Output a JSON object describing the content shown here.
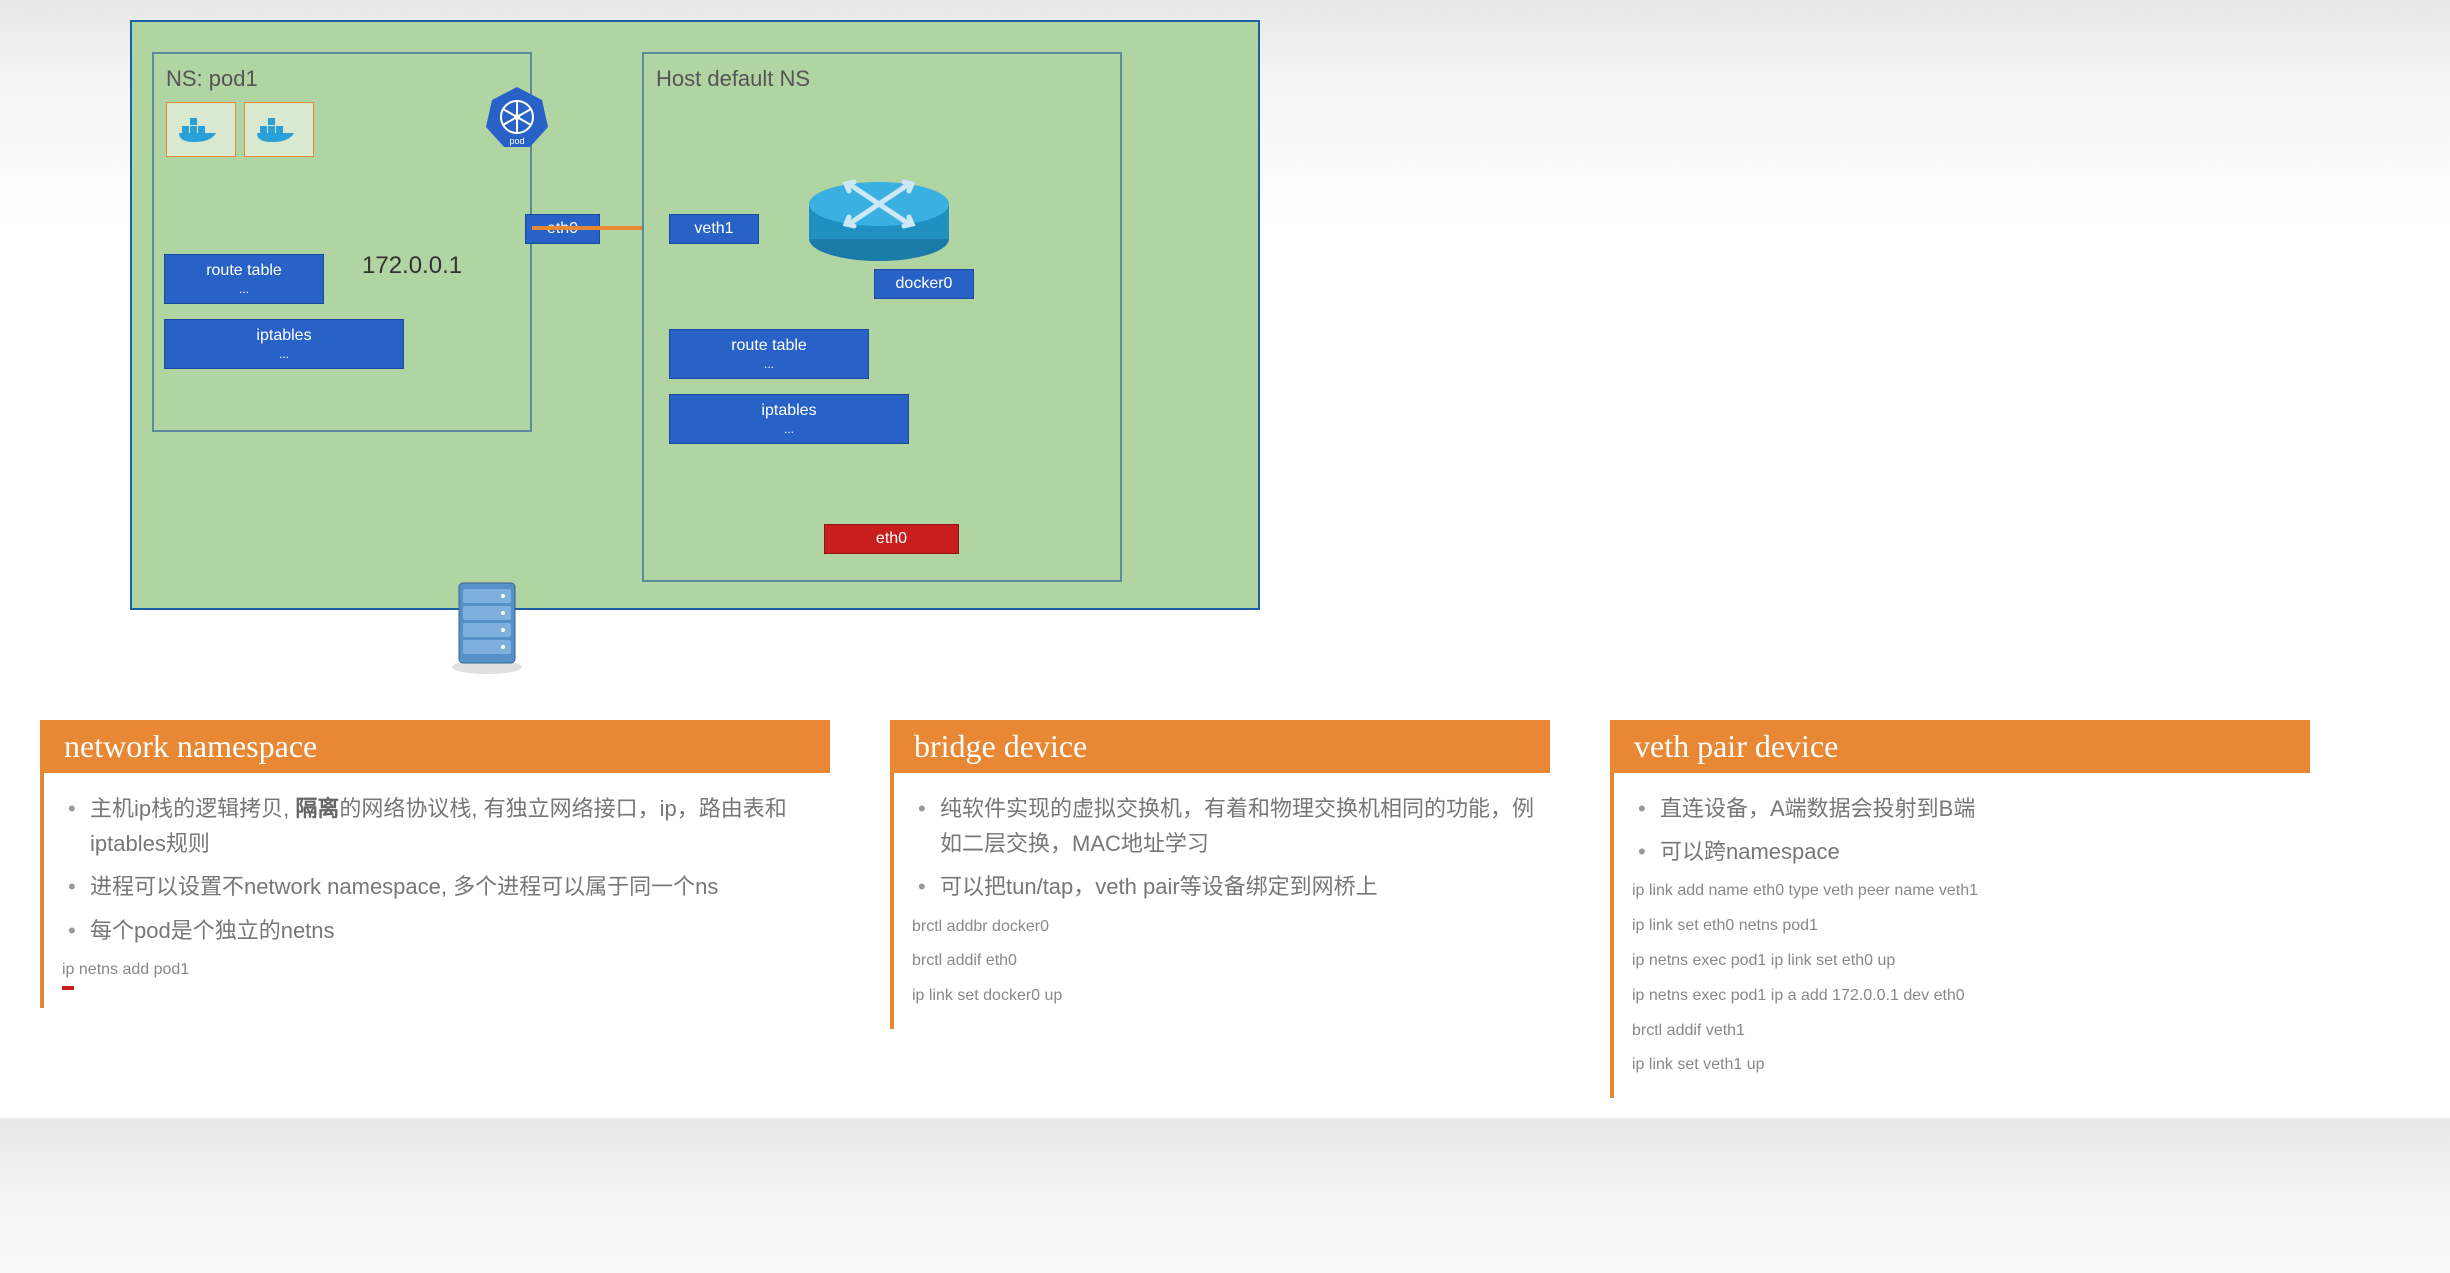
{
  "diagram": {
    "pod1": {
      "title": "NS: pod1",
      "eth0": "eth0",
      "ip": "172.0.0.1",
      "route_table": "route table",
      "route_sub": "...",
      "iptables": "iptables",
      "iptables_sub": "..."
    },
    "host": {
      "title": "Host default NS",
      "veth1": "veth1",
      "docker0": "docker0",
      "route_table": "route table",
      "route_sub": "...",
      "iptables": "iptables",
      "iptables_sub": "...",
      "eth0": "eth0"
    },
    "k8s_label": "pod"
  },
  "cards": {
    "netns": {
      "title": "network namespace",
      "bullets": [
        "主机ip栈的逻辑拷贝, 隔离的网络协议栈, 有独立网络接口，ip，路由表和iptables规则",
        "进程可以设置不network namespace, 多个进程可以属于同一个ns",
        "每个pod是个独立的netns"
      ],
      "cmds": [
        "ip netns add pod1"
      ]
    },
    "bridge": {
      "title": "bridge device",
      "bullets": [
        "纯软件实现的虚拟交换机，有着和物理交换机相同的功能，例如二层交换，MAC地址学习",
        "可以把tun/tap，veth pair等设备绑定到网桥上"
      ],
      "cmds": [
        "brctl addbr docker0",
        "brctl addif eth0",
        "ip link set docker0 up"
      ]
    },
    "veth": {
      "title": "veth pair device",
      "bullets": [
        "直连设备，A端数据会投射到B端",
        "可以跨namespace"
      ],
      "cmds": [
        "ip link add name eth0 type veth peer name veth1",
        "ip link set eth0 netns pod1",
        "ip netns exec pod1 ip link set eth0 up",
        "ip netns exec pod1 ip a add 172.0.0.1 dev eth0",
        "brctl addif veth1",
        "ip link set veth1 up"
      ]
    }
  }
}
